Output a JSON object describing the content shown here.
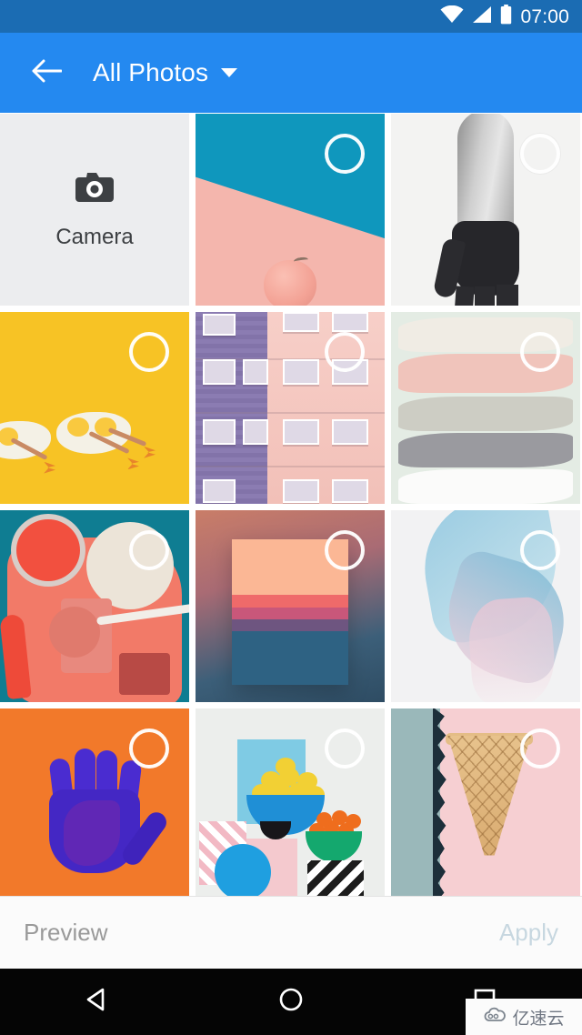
{
  "status_bar": {
    "time": "07:00",
    "icons": [
      "wifi-icon",
      "cellular-signal-icon",
      "battery-icon"
    ],
    "background": "#1b6cb3"
  },
  "app_bar": {
    "back_icon": "back-arrow-icon",
    "title": "All Photos",
    "dropdown_icon": "chevron-down-icon",
    "background": "#2489f0",
    "text_color": "#ffffff"
  },
  "grid": {
    "columns": 3,
    "rows": 4,
    "camera_tile": {
      "label": "Camera",
      "icon": "camera-icon",
      "background": "#ecedef",
      "selected": false
    },
    "photos": [
      {
        "id": 1,
        "alt": "Pink apple on teal and pink diagonal background",
        "selected": false,
        "check_style": "bright"
      },
      {
        "id": 2,
        "alt": "Black and white hand dipped in black paint",
        "selected": false,
        "check_style": "faint"
      },
      {
        "id": 3,
        "alt": "Fried eggs with chicken legs on yellow background",
        "selected": false,
        "check_style": "bright"
      },
      {
        "id": 4,
        "alt": "Purple and pink apartment building facade",
        "selected": false,
        "check_style": "bright"
      },
      {
        "id": 5,
        "alt": "Pastel paint smear swatches",
        "selected": false,
        "check_style": "bright"
      },
      {
        "id": 6,
        "alt": "Coral cosmetics flat lay on teal background",
        "selected": false,
        "check_style": "bright"
      },
      {
        "id": 7,
        "alt": "Gradient color palette card",
        "selected": false,
        "check_style": "bright"
      },
      {
        "id": 8,
        "alt": "Translucent blue and pink fabric",
        "selected": false,
        "check_style": "bright"
      },
      {
        "id": 9,
        "alt": "Purple painted hand on orange background",
        "selected": false,
        "check_style": "bright"
      },
      {
        "id": 10,
        "alt": "Bowls of lemons and oranges still life",
        "selected": false,
        "check_style": "bright"
      },
      {
        "id": 11,
        "alt": "Waffle ice cream cone on torn pink paper",
        "selected": false,
        "check_style": "bright"
      }
    ]
  },
  "action_bar": {
    "preview_label": "Preview",
    "preview_color": "#9a9a9a",
    "apply_label": "Apply",
    "apply_color": "#c7d7e0",
    "apply_enabled": false
  },
  "nav_bar": {
    "back_icon": "nav-back-triangle-icon",
    "home_icon": "nav-home-circle-icon",
    "recents_icon": "nav-recents-square-icon",
    "background": "#050505"
  },
  "watermark": {
    "icon": "cloud-icon",
    "text": "亿速云"
  }
}
